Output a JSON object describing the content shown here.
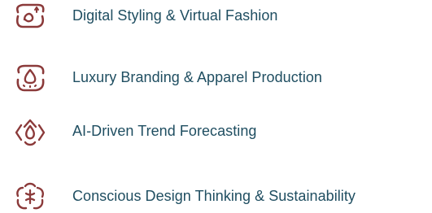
{
  "colors": {
    "icon": "#8b3a3a",
    "text": "#1f4e61"
  },
  "items": [
    {
      "icon": "sparkle-face-frame-icon",
      "label": "Digital Styling & Virtual Fashion"
    },
    {
      "icon": "droplet-frame-icon",
      "label": "Luxury Branding & Apparel Production"
    },
    {
      "icon": "diamond-chevrons-icon",
      "label": "AI-Driven Trend Forecasting"
    },
    {
      "icon": "flower-cycle-icon",
      "label": "Conscious Design Thinking & Sustainability"
    }
  ]
}
